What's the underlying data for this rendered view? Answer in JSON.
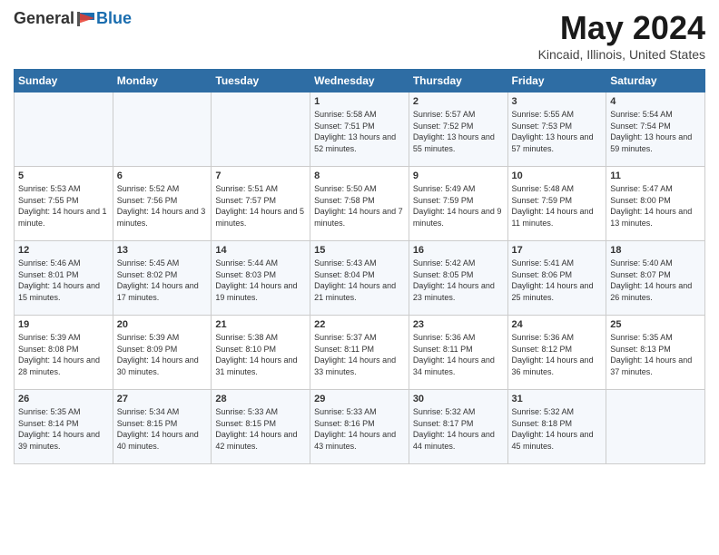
{
  "header": {
    "logo_general": "General",
    "logo_blue": "Blue",
    "month_title": "May 2024",
    "location": "Kincaid, Illinois, United States"
  },
  "weekdays": [
    "Sunday",
    "Monday",
    "Tuesday",
    "Wednesday",
    "Thursday",
    "Friday",
    "Saturday"
  ],
  "weeks": [
    [
      {
        "day": "",
        "sunrise": "",
        "sunset": "",
        "daylight": ""
      },
      {
        "day": "",
        "sunrise": "",
        "sunset": "",
        "daylight": ""
      },
      {
        "day": "",
        "sunrise": "",
        "sunset": "",
        "daylight": ""
      },
      {
        "day": "1",
        "sunrise": "Sunrise: 5:58 AM",
        "sunset": "Sunset: 7:51 PM",
        "daylight": "Daylight: 13 hours and 52 minutes."
      },
      {
        "day": "2",
        "sunrise": "Sunrise: 5:57 AM",
        "sunset": "Sunset: 7:52 PM",
        "daylight": "Daylight: 13 hours and 55 minutes."
      },
      {
        "day": "3",
        "sunrise": "Sunrise: 5:55 AM",
        "sunset": "Sunset: 7:53 PM",
        "daylight": "Daylight: 13 hours and 57 minutes."
      },
      {
        "day": "4",
        "sunrise": "Sunrise: 5:54 AM",
        "sunset": "Sunset: 7:54 PM",
        "daylight": "Daylight: 13 hours and 59 minutes."
      }
    ],
    [
      {
        "day": "5",
        "sunrise": "Sunrise: 5:53 AM",
        "sunset": "Sunset: 7:55 PM",
        "daylight": "Daylight: 14 hours and 1 minute."
      },
      {
        "day": "6",
        "sunrise": "Sunrise: 5:52 AM",
        "sunset": "Sunset: 7:56 PM",
        "daylight": "Daylight: 14 hours and 3 minutes."
      },
      {
        "day": "7",
        "sunrise": "Sunrise: 5:51 AM",
        "sunset": "Sunset: 7:57 PM",
        "daylight": "Daylight: 14 hours and 5 minutes."
      },
      {
        "day": "8",
        "sunrise": "Sunrise: 5:50 AM",
        "sunset": "Sunset: 7:58 PM",
        "daylight": "Daylight: 14 hours and 7 minutes."
      },
      {
        "day": "9",
        "sunrise": "Sunrise: 5:49 AM",
        "sunset": "Sunset: 7:59 PM",
        "daylight": "Daylight: 14 hours and 9 minutes."
      },
      {
        "day": "10",
        "sunrise": "Sunrise: 5:48 AM",
        "sunset": "Sunset: 7:59 PM",
        "daylight": "Daylight: 14 hours and 11 minutes."
      },
      {
        "day": "11",
        "sunrise": "Sunrise: 5:47 AM",
        "sunset": "Sunset: 8:00 PM",
        "daylight": "Daylight: 14 hours and 13 minutes."
      }
    ],
    [
      {
        "day": "12",
        "sunrise": "Sunrise: 5:46 AM",
        "sunset": "Sunset: 8:01 PM",
        "daylight": "Daylight: 14 hours and 15 minutes."
      },
      {
        "day": "13",
        "sunrise": "Sunrise: 5:45 AM",
        "sunset": "Sunset: 8:02 PM",
        "daylight": "Daylight: 14 hours and 17 minutes."
      },
      {
        "day": "14",
        "sunrise": "Sunrise: 5:44 AM",
        "sunset": "Sunset: 8:03 PM",
        "daylight": "Daylight: 14 hours and 19 minutes."
      },
      {
        "day": "15",
        "sunrise": "Sunrise: 5:43 AM",
        "sunset": "Sunset: 8:04 PM",
        "daylight": "Daylight: 14 hours and 21 minutes."
      },
      {
        "day": "16",
        "sunrise": "Sunrise: 5:42 AM",
        "sunset": "Sunset: 8:05 PM",
        "daylight": "Daylight: 14 hours and 23 minutes."
      },
      {
        "day": "17",
        "sunrise": "Sunrise: 5:41 AM",
        "sunset": "Sunset: 8:06 PM",
        "daylight": "Daylight: 14 hours and 25 minutes."
      },
      {
        "day": "18",
        "sunrise": "Sunrise: 5:40 AM",
        "sunset": "Sunset: 8:07 PM",
        "daylight": "Daylight: 14 hours and 26 minutes."
      }
    ],
    [
      {
        "day": "19",
        "sunrise": "Sunrise: 5:39 AM",
        "sunset": "Sunset: 8:08 PM",
        "daylight": "Daylight: 14 hours and 28 minutes."
      },
      {
        "day": "20",
        "sunrise": "Sunrise: 5:39 AM",
        "sunset": "Sunset: 8:09 PM",
        "daylight": "Daylight: 14 hours and 30 minutes."
      },
      {
        "day": "21",
        "sunrise": "Sunrise: 5:38 AM",
        "sunset": "Sunset: 8:10 PM",
        "daylight": "Daylight: 14 hours and 31 minutes."
      },
      {
        "day": "22",
        "sunrise": "Sunrise: 5:37 AM",
        "sunset": "Sunset: 8:11 PM",
        "daylight": "Daylight: 14 hours and 33 minutes."
      },
      {
        "day": "23",
        "sunrise": "Sunrise: 5:36 AM",
        "sunset": "Sunset: 8:11 PM",
        "daylight": "Daylight: 14 hours and 34 minutes."
      },
      {
        "day": "24",
        "sunrise": "Sunrise: 5:36 AM",
        "sunset": "Sunset: 8:12 PM",
        "daylight": "Daylight: 14 hours and 36 minutes."
      },
      {
        "day": "25",
        "sunrise": "Sunrise: 5:35 AM",
        "sunset": "Sunset: 8:13 PM",
        "daylight": "Daylight: 14 hours and 37 minutes."
      }
    ],
    [
      {
        "day": "26",
        "sunrise": "Sunrise: 5:35 AM",
        "sunset": "Sunset: 8:14 PM",
        "daylight": "Daylight: 14 hours and 39 minutes."
      },
      {
        "day": "27",
        "sunrise": "Sunrise: 5:34 AM",
        "sunset": "Sunset: 8:15 PM",
        "daylight": "Daylight: 14 hours and 40 minutes."
      },
      {
        "day": "28",
        "sunrise": "Sunrise: 5:33 AM",
        "sunset": "Sunset: 8:15 PM",
        "daylight": "Daylight: 14 hours and 42 minutes."
      },
      {
        "day": "29",
        "sunrise": "Sunrise: 5:33 AM",
        "sunset": "Sunset: 8:16 PM",
        "daylight": "Daylight: 14 hours and 43 minutes."
      },
      {
        "day": "30",
        "sunrise": "Sunrise: 5:32 AM",
        "sunset": "Sunset: 8:17 PM",
        "daylight": "Daylight: 14 hours and 44 minutes."
      },
      {
        "day": "31",
        "sunrise": "Sunrise: 5:32 AM",
        "sunset": "Sunset: 8:18 PM",
        "daylight": "Daylight: 14 hours and 45 minutes."
      },
      {
        "day": "",
        "sunrise": "",
        "sunset": "",
        "daylight": ""
      }
    ]
  ]
}
